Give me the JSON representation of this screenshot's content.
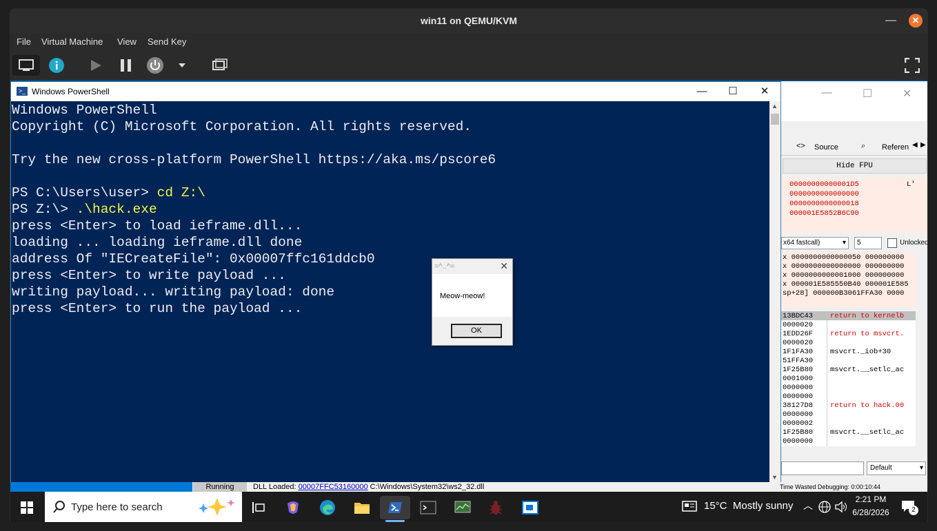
{
  "vm": {
    "title": "win11 on QEMU/KVM",
    "menu": [
      "File",
      "Virtual Machine",
      "View",
      "Send Key"
    ]
  },
  "powershell": {
    "title": "Windows PowerShell",
    "lines": [
      {
        "prompt": "Windows PowerShell",
        "cmd": ""
      },
      {
        "prompt": "Copyright (C) Microsoft Corporation. All rights reserved.",
        "cmd": ""
      },
      {
        "prompt": "",
        "cmd": ""
      },
      {
        "prompt": "Try the new cross-platform PowerShell https://aka.ms/pscore6",
        "cmd": ""
      },
      {
        "prompt": "",
        "cmd": ""
      },
      {
        "prompt": "PS C:\\Users\\user> ",
        "cmd": "cd Z:\\"
      },
      {
        "prompt": "PS Z:\\> ",
        "cmd": ".\\hack.exe"
      },
      {
        "prompt": "press <Enter> to load ieframe.dll...",
        "cmd": ""
      },
      {
        "prompt": "loading ... loading ieframe.dll done",
        "cmd": ""
      },
      {
        "prompt": "address Of \"IECreateFile\": 0x00007ffc161ddcb0",
        "cmd": ""
      },
      {
        "prompt": "press <Enter> to write payload ...",
        "cmd": ""
      },
      {
        "prompt": "writing payload... writing payload: done",
        "cmd": ""
      },
      {
        "prompt": "press <Enter> to run the payload ...",
        "cmd": ""
      }
    ]
  },
  "msgbox": {
    "title": "=^..^=",
    "text": "Meow-meow!",
    "ok": "OK"
  },
  "debugger": {
    "tabs": [
      "Source",
      "Referen"
    ],
    "hide_fpu": "Hide FPU",
    "regs": [
      "00000000000001D5",
      "0000000000000000",
      "0000000000000018",
      "000001E5852B6C90"
    ],
    "reg_side": "L'",
    "callconv": "x64 fastcall)",
    "arg_count": "5",
    "unlocked": "Unlocked",
    "args": [
      "x 0000000000000050 000000000",
      "x 0000000000000000 000000000",
      "x 0000000000001000 000000000",
      "x 000001E585550B40 000001E585",
      "sp+28] 000000B3061FFA30 0000"
    ],
    "stack": [
      {
        "addr": "13BDC43",
        "cmt": "return to kernelb",
        "red": true
      },
      {
        "addr": "0000020",
        "cmt": "",
        "red": false
      },
      {
        "addr": "1EDD26F",
        "cmt": "return to msvcrt.",
        "red": true
      },
      {
        "addr": "0000020",
        "cmt": "",
        "red": false
      },
      {
        "addr": "1F1FA30",
        "cmt": "msvcrt._iob+30",
        "red": false
      },
      {
        "addr": "51FFA30",
        "cmt": "",
        "red": false
      },
      {
        "addr": "1F25B80",
        "cmt": "msvcrt.__setlc_ac",
        "red": false
      },
      {
        "addr": "0001000",
        "cmt": "",
        "red": false
      },
      {
        "addr": "0000000",
        "cmt": "",
        "red": false
      },
      {
        "addr": "0000000",
        "cmt": "",
        "red": false
      },
      {
        "addr": "38127D8",
        "cmt": "return to hack.00",
        "red": true
      },
      {
        "addr": "0000000",
        "cmt": "",
        "red": false
      },
      {
        "addr": "0000002",
        "cmt": "",
        "red": false
      },
      {
        "addr": "1F25B80",
        "cmt": "msvcrt.__setlc_ac",
        "red": false
      },
      {
        "addr": "0000000",
        "cmt": "",
        "red": false
      }
    ],
    "default_label": "Default"
  },
  "status": {
    "running": "Running",
    "dll_prefix": "DLL Loaded: ",
    "dll_addr": "00007FFC53160000",
    "dll_path": " C:\\Windows\\System32\\ws2_32.dll",
    "time_wasted": "Time Wasted Debugging: 0:00:10:44"
  },
  "taskbar": {
    "search_placeholder": "Type here to search",
    "weather": "15°C  Mostly sunny",
    "time": "2:21 PM",
    "date": "6/28/2026",
    "notifications": "2"
  },
  "colors": {
    "ps_bg": "#012456",
    "ps_cmd": "#f5f543",
    "vm_close": "#f0782e",
    "taskbar_bg": "#1c1c1c"
  }
}
